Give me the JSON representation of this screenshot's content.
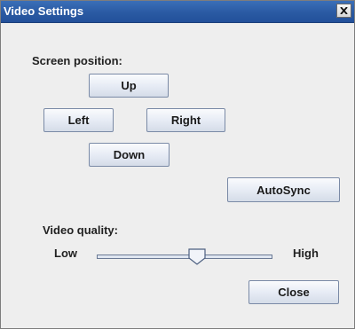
{
  "window": {
    "title": "Video Settings",
    "close_glyph": "X"
  },
  "screen_position": {
    "label": "Screen position:",
    "up": "Up",
    "left": "Left",
    "right": "Right",
    "down": "Down"
  },
  "autosync_label": "AutoSync",
  "video_quality": {
    "label": "Video quality:",
    "low": "Low",
    "high": "High",
    "value": 0.57
  },
  "close_button": "Close",
  "icons": {
    "window_close": "close-icon",
    "slider_thumb": "slider-thumb"
  }
}
